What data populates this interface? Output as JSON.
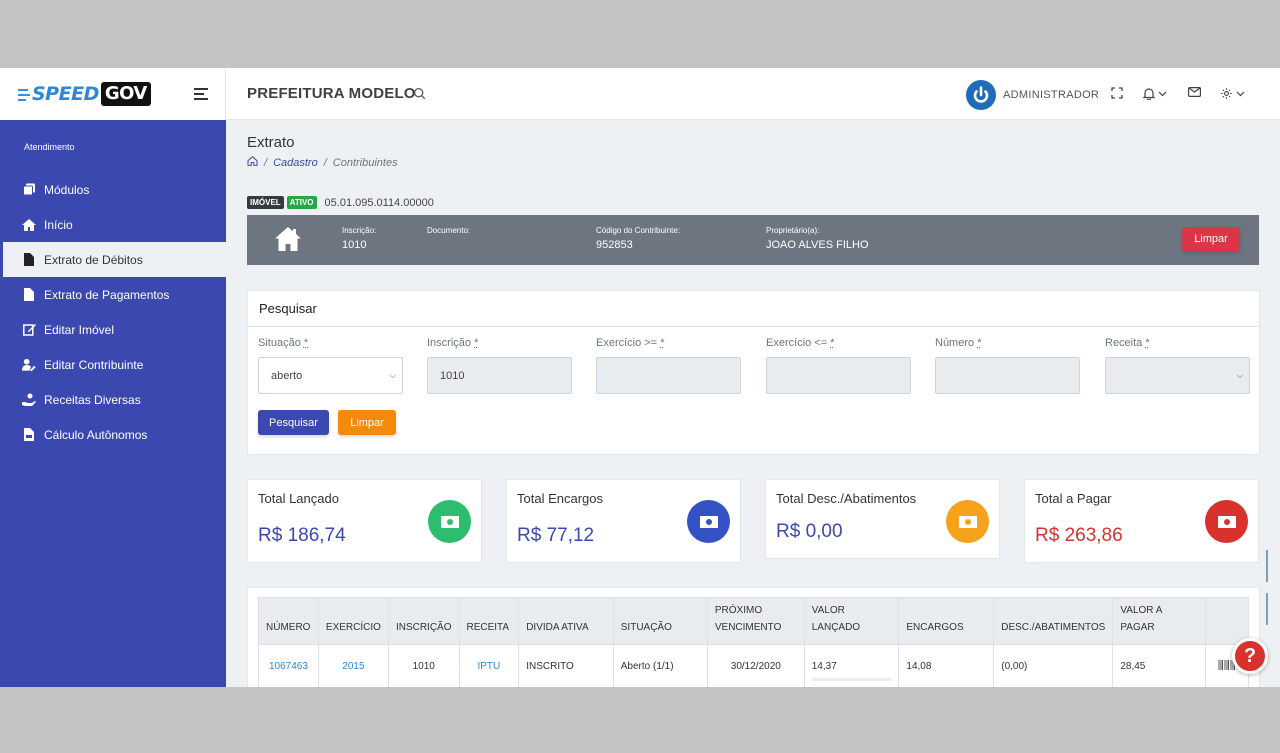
{
  "brand": {
    "speed": "SPEED",
    "gov": "GOV"
  },
  "header": {
    "title": "PREFEITURA MODELO",
    "user": "ADMINISTRADOR"
  },
  "sidebar": {
    "section": "Atendimento",
    "items": [
      {
        "label": "Módulos",
        "icon": "copy-icon"
      },
      {
        "label": "Início",
        "icon": "home-icon"
      },
      {
        "label": "Extrato de Débitos",
        "icon": "file-icon",
        "active": true
      },
      {
        "label": "Extrato de Pagamentos",
        "icon": "file-icon"
      },
      {
        "label": "Editar Imóvel",
        "icon": "edit-icon"
      },
      {
        "label": "Editar Contribuinte",
        "icon": "user-edit-icon"
      },
      {
        "label": "Receitas Diversas",
        "icon": "hand-coin-icon"
      },
      {
        "label": "Cálculo Autônomos",
        "icon": "file-invoice-icon"
      }
    ]
  },
  "page": {
    "title": "Extrato",
    "breadcrumb": [
      "Cadastro",
      "Contribuintes"
    ]
  },
  "property": {
    "tag_type": "IMÓVEL",
    "tag_status": "ATIVO",
    "code": "05.01.095.0114.00000",
    "fields": [
      {
        "label": "Inscrição:",
        "value": "1010"
      },
      {
        "label": "Documento:",
        "value": ""
      },
      {
        "label": "Código do Contribuinte:",
        "value": "952853"
      },
      {
        "label": "Proprietário(a):",
        "value": "JOAO ALVES FILHO"
      }
    ],
    "clear_label": "Limpar"
  },
  "search": {
    "title": "Pesquisar",
    "fields": [
      {
        "label": "Situação",
        "value": "aberto",
        "type": "select"
      },
      {
        "label": "Inscrição",
        "value": "1010",
        "type": "input"
      },
      {
        "label": "Exercício >=",
        "value": "",
        "type": "input"
      },
      {
        "label": "Exercício <=",
        "value": "",
        "type": "input"
      },
      {
        "label": "Número",
        "value": "",
        "type": "input"
      },
      {
        "label": "Receita",
        "value": "",
        "type": "select"
      }
    ],
    "required_mark": "*",
    "search_label": "Pesquisar",
    "clear_label": "Limpar"
  },
  "stats": [
    {
      "label": "Total Lançado",
      "value": "R$ 186,74",
      "color": "#3b48b0",
      "icon_bg": "#2dbd6e"
    },
    {
      "label": "Total Encargos",
      "value": "R$ 77,12",
      "color": "#3b48b0",
      "icon_bg": "#3451c6"
    },
    {
      "label": "Total Desc./Abatimentos",
      "value": "R$ 0,00",
      "color": "#3b48b0",
      "icon_bg": "#f6a21d"
    },
    {
      "label": "Total a Pagar",
      "value": "R$ 263,86",
      "color": "#d9312c",
      "icon_bg": "#d9312c"
    }
  ],
  "table": {
    "headers": [
      "NÚMERO",
      "EXERCÍCIO",
      "INSCRIÇÃO",
      "RECEITA",
      "DIVIDA ATIVA",
      "SITUAÇÃO",
      "PRÓXIMO VENCIMENTO",
      "VALOR LANÇADO",
      "ENCARGOS",
      "DESC./ABATIMENTOS",
      "VALOR A PAGAR",
      ""
    ],
    "rows": [
      {
        "numero": "1067463",
        "exercicio": "2015",
        "inscricao": "1010",
        "receita": "IPTU",
        "divida": "INSCRITO",
        "situacao": "Aberto (1/1)",
        "vencimento": "30/12/2020",
        "lancado": "14,37",
        "encargos": "14,08",
        "desc": "(0,00)",
        "pagar": "28,45"
      }
    ]
  },
  "help_label": "?"
}
